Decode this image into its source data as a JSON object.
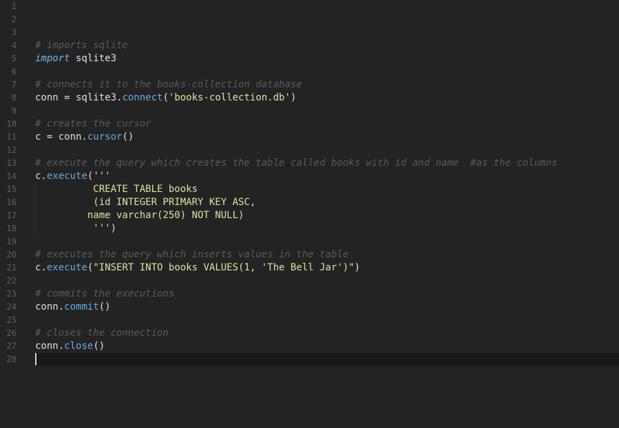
{
  "editor": {
    "lines": [
      {
        "n": "1",
        "t": []
      },
      {
        "n": "2",
        "t": []
      },
      {
        "n": "3",
        "t": []
      },
      {
        "n": "4",
        "t": [
          {
            "s": "# imports sqlite",
            "c": "cm"
          }
        ]
      },
      {
        "n": "5",
        "t": [
          {
            "s": "import",
            "c": "kw"
          },
          {
            "s": " sqlite3",
            "c": "pl"
          }
        ]
      },
      {
        "n": "6",
        "t": []
      },
      {
        "n": "7",
        "t": [
          {
            "s": "# connects it to the books-collection database",
            "c": "cm"
          }
        ]
      },
      {
        "n": "8",
        "t": [
          {
            "s": "conn = sqlite3.",
            "c": "pl"
          },
          {
            "s": "connect",
            "c": "fn"
          },
          {
            "s": "(",
            "c": "pl"
          },
          {
            "s": "'books-collection.db'",
            "c": "st"
          },
          {
            "s": ")",
            "c": "pl"
          }
        ]
      },
      {
        "n": "9",
        "t": []
      },
      {
        "n": "10",
        "t": [
          {
            "s": "# creates the cursor",
            "c": "cm"
          }
        ]
      },
      {
        "n": "11",
        "t": [
          {
            "s": "c = conn.",
            "c": "pl"
          },
          {
            "s": "cursor",
            "c": "fn"
          },
          {
            "s": "()",
            "c": "pl"
          }
        ]
      },
      {
        "n": "12",
        "t": []
      },
      {
        "n": "13",
        "t": [
          {
            "s": "# execute the query which creates the table called books with id and name  #as the columns",
            "c": "cm"
          }
        ]
      },
      {
        "n": "14",
        "t": [
          {
            "s": "c.",
            "c": "pl"
          },
          {
            "s": "execute",
            "c": "fn"
          },
          {
            "s": "(",
            "c": "pl"
          },
          {
            "s": "'''",
            "c": "st"
          }
        ]
      },
      {
        "n": "15",
        "t": [
          {
            "s": "          CREATE TABLE books",
            "c": "st"
          }
        ]
      },
      {
        "n": "16",
        "t": [
          {
            "s": "          (id INTEGER PRIMARY KEY ASC,",
            "c": "st"
          }
        ]
      },
      {
        "n": "17",
        "t": [
          {
            "s": "         name varchar(250) NOT NULL)",
            "c": "st"
          }
        ]
      },
      {
        "n": "18",
        "t": [
          {
            "s": "          ''')",
            "c": "st"
          }
        ]
      },
      {
        "n": "19",
        "t": []
      },
      {
        "n": "20",
        "t": [
          {
            "s": "# executes the query which inserts values in the table",
            "c": "cm"
          }
        ]
      },
      {
        "n": "21",
        "t": [
          {
            "s": "c.",
            "c": "pl"
          },
          {
            "s": "execute",
            "c": "fn"
          },
          {
            "s": "(",
            "c": "pl"
          },
          {
            "s": "\"INSERT INTO books VALUES(1, 'The Bell Jar')\"",
            "c": "st"
          },
          {
            "s": ")",
            "c": "pl"
          }
        ]
      },
      {
        "n": "22",
        "t": []
      },
      {
        "n": "23",
        "t": [
          {
            "s": "# commits the executions",
            "c": "cm"
          }
        ]
      },
      {
        "n": "24",
        "t": [
          {
            "s": "conn.",
            "c": "pl"
          },
          {
            "s": "commit",
            "c": "fn"
          },
          {
            "s": "()",
            "c": "pl"
          }
        ]
      },
      {
        "n": "25",
        "t": []
      },
      {
        "n": "26",
        "t": [
          {
            "s": "# closes the connection",
            "c": "cm"
          }
        ]
      },
      {
        "n": "27",
        "t": [
          {
            "s": "conn.",
            "c": "pl"
          },
          {
            "s": "close",
            "c": "fn"
          },
          {
            "s": "()",
            "c": "pl"
          }
        ]
      },
      {
        "n": "28",
        "t": []
      }
    ],
    "active_line": 28
  }
}
